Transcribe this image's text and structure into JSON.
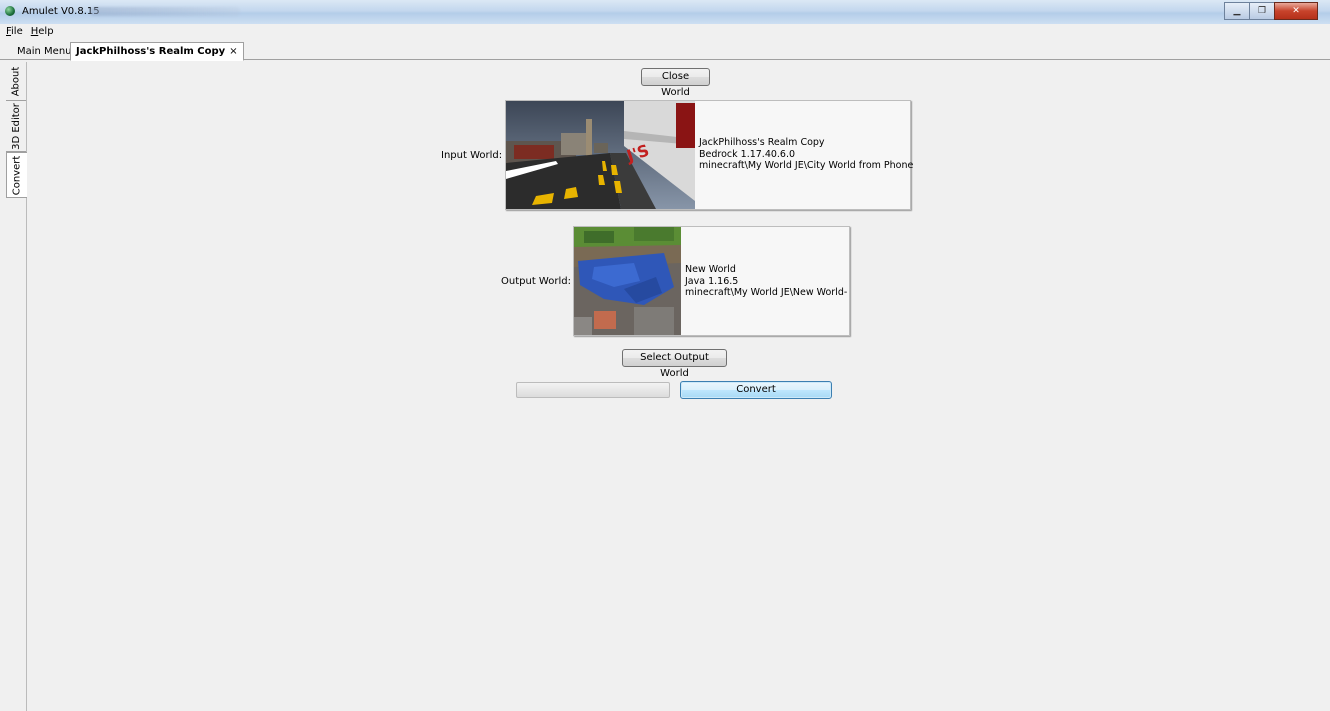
{
  "window": {
    "title": "Amulet V0.8.15",
    "controls": [
      "minimize-icon",
      "maximize-icon",
      "close-icon"
    ]
  },
  "menu": {
    "file_rest": "ile",
    "file_mnemonic": "F",
    "help_rest": "elp",
    "help_mnemonic": "H"
  },
  "tabs": {
    "main_menu": "Main Menu",
    "active": "JackPhilhoss's Realm Copy",
    "active_close": "×"
  },
  "side_tabs": {
    "about": "About",
    "editor": "3D Editor",
    "convert": "Convert"
  },
  "convert_panel": {
    "close_world": "Close World",
    "input_label": "Input World:",
    "input_world": {
      "name": "JackPhilhoss's Realm Copy",
      "version": "Bedrock 1.17.40.6.0",
      "path": "minecraft\\My World JE\\City World from Phone"
    },
    "output_label": "Output World:",
    "output_world": {
      "name": "New World",
      "version": "Java 1.16.5",
      "path": "minecraft\\My World JE\\New World-"
    },
    "select_output": "Select Output World",
    "convert": "Convert",
    "progress": 0
  }
}
